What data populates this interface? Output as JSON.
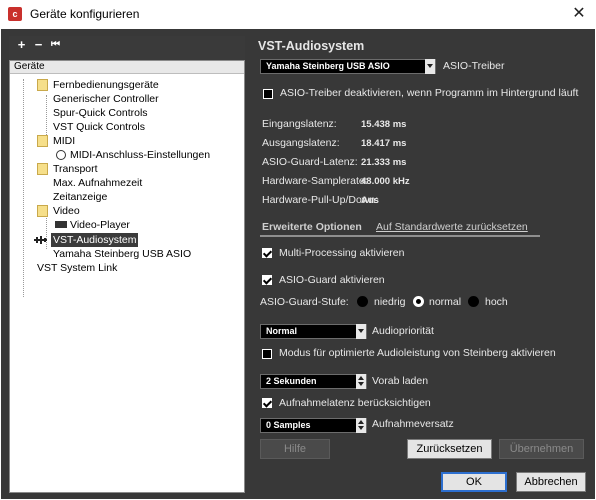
{
  "window": {
    "title": "Geräte konfigurieren",
    "close_glyph": "✕"
  },
  "toolbar": {
    "add": "+",
    "remove": "−",
    "reset": "⏮"
  },
  "tree": {
    "header": "Geräte",
    "items": [
      {
        "label": "Fernbedienungsgeräte"
      },
      {
        "label": "Generischer Controller"
      },
      {
        "label": "Spur-Quick Controls"
      },
      {
        "label": "VST Quick Controls"
      },
      {
        "label": "MIDI"
      },
      {
        "label": "MIDI-Anschluss-Einstellungen"
      },
      {
        "label": "Transport"
      },
      {
        "label": "Max. Aufnahmezeit"
      },
      {
        "label": "Zeitanzeige"
      },
      {
        "label": "Video"
      },
      {
        "label": "Video-Player"
      },
      {
        "label": "VST-Audiosystem"
      },
      {
        "label": "Yamaha Steinberg USB ASIO"
      },
      {
        "label": "VST System Link"
      }
    ]
  },
  "panel": {
    "title": "VST-Audiosystem",
    "driver_select": "Yamaha Steinberg USB ASIO",
    "driver_label": "ASIO-Treiber",
    "deactivate_label": "ASIO-Treiber deaktivieren, wenn Programm im Hintergrund läuft",
    "stats": [
      {
        "label": "Eingangslatenz:",
        "value": "15.438 ms"
      },
      {
        "label": "Ausgangslatenz:",
        "value": "18.417 ms"
      },
      {
        "label": "ASIO-Guard-Latenz:",
        "value": "21.333 ms"
      },
      {
        "label": "Hardware-Samplerate:",
        "value": "48.000 kHz"
      },
      {
        "label": "Hardware-Pull-Up/Down:",
        "value": "Aus"
      }
    ],
    "tab_advanced": "Erweiterte Optionen",
    "tab_reset_defaults": "Auf Standardwerte zurücksetzen",
    "multiprocessing_label": "Multi-Processing aktivieren",
    "asio_guard_label": "ASIO-Guard aktivieren",
    "asio_guard_level_label": "ASIO-Guard-Stufe:",
    "radio_low": "niedrig",
    "radio_normal": "normal",
    "radio_high": "hoch",
    "priority_select": "Normal",
    "priority_label": "Audiopriorität",
    "steinberg_mode_label": "Modus für optimierte Audioleistung von Steinberg aktivieren",
    "preload_value": "2 Sekunden",
    "preload_label": "Vorab laden",
    "rec_latency_label": "Aufnahmelatenz berücksichtigen",
    "rec_offset_value": "0 Samples",
    "rec_offset_label": "Aufnahmeversatz"
  },
  "buttons": {
    "help": "Hilfe",
    "reset": "Zurücksetzen",
    "apply": "Übernehmen",
    "ok": "OK",
    "cancel": "Abbrechen"
  }
}
